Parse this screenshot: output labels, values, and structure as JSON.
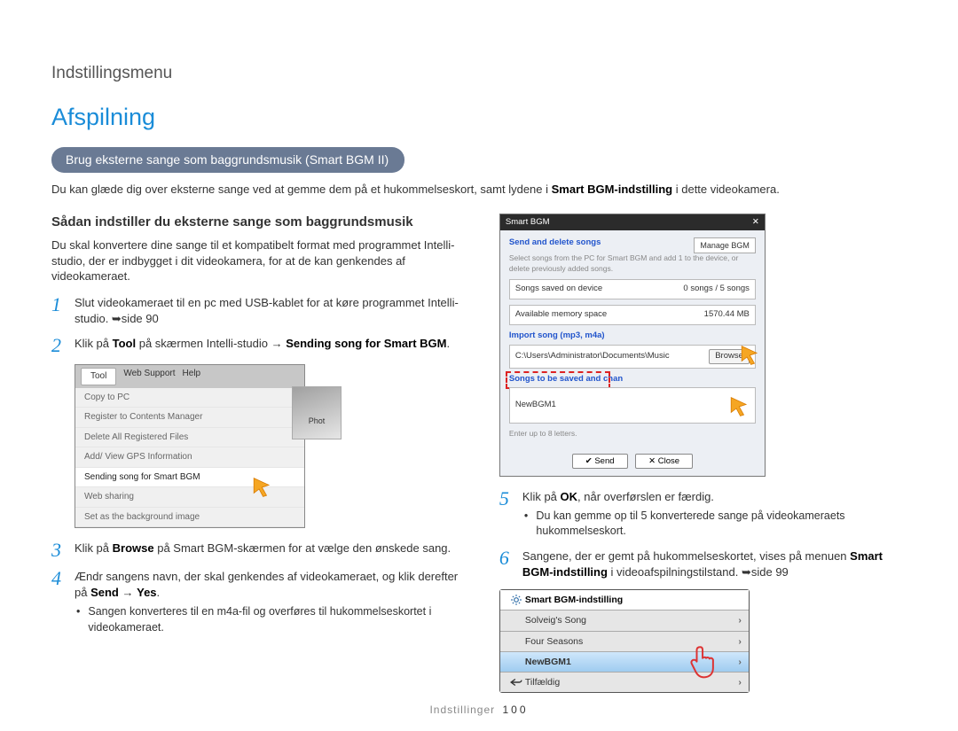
{
  "breadcrumb": "Indstillingsmenu",
  "title": "Afspilning",
  "pill": "Brug eksterne sange som baggrundsmusik (Smart BGM II)",
  "intro_pre": "Du kan glæde dig over eksterne sange ved at gemme dem på et hukommelseskort, samt lydene i ",
  "intro_bold": "Smart BGM-indstilling",
  "intro_post": " i dette videokamera.",
  "subhead": "Sådan indstiller du eksterne sange som baggrundsmusik",
  "para1": "Du skal konvertere dine sange til et kompatibelt format med programmet Intelli-studio, der er indbygget i dit videokamera, for at de kan genkendes af videokameraet.",
  "steps": {
    "s1": {
      "n": "1",
      "t": "Slut videokameraet til en pc med USB-kablet for at køre programmet Intelli-studio. ➥side 90"
    },
    "s2": {
      "n": "2",
      "pre": "Klik på ",
      "b1": "Tool",
      "mid1": " på skærmen Intelli-studio → ",
      "b2": "Sending song for Smart BGM",
      "post": "."
    },
    "s3": {
      "n": "3",
      "pre": "Klik på ",
      "b1": "Browse",
      "post": " på Smart BGM-skærmen for at vælge den ønskede sang."
    },
    "s4": {
      "n": "4",
      "pre": "Ændr sangens navn, der skal genkendes af videokameraet, og klik derefter på ",
      "b1": "Send",
      "mid": " → ",
      "b2": "Yes",
      "post": ".",
      "bullet": "Sangen konverteres til en m4a-fil og overføres til hukommelseskortet i videokameraet."
    },
    "s5": {
      "n": "5",
      "pre": "Klik på ",
      "b1": "OK",
      "post": ", når overførslen er færdig.",
      "bullet": "Du kan gemme op til 5 konverterede sange på videokameraets hukommelseskort."
    },
    "s6": {
      "n": "6",
      "pre": "Sangene, der er gemt på hukommelseskortet, vises på menuen ",
      "b1": "Smart BGM-indstilling",
      "post": " i videoafspilningstilstand. ➥side 99"
    }
  },
  "fig_menu": {
    "tb1": "Tool",
    "tb2": "Web Support",
    "tb3": "Help",
    "items": [
      "Copy to PC",
      "Register to Contents Manager",
      "Delete All Registered Files",
      "Add/ View GPS Information",
      "Sending song for Smart BGM",
      "Web sharing",
      "Set as the background image"
    ],
    "highlight_idx": 4,
    "photo_label": "Phot"
  },
  "fig_dialog": {
    "title": "Smart BGM",
    "link1": "Send and delete songs",
    "mgmt": "Manage BGM",
    "sub1": "Select songs from the PC for Smart BGM and add 1 to the device, or delete previously added songs.",
    "row1_l": "Songs saved on device",
    "row1_r": "0 songs / 5 songs",
    "row2_l": "Available memory space",
    "row2_r": "1570.44 MB",
    "link2": "Import song (mp3, m4a)",
    "path": "C:\\Users\\Administrator\\Documents\\Music",
    "browse": "Browse",
    "link3": "Songs to be saved and chan",
    "name_val": "NewBGM1",
    "name_hint": "Enter up to 8 letters.",
    "btn_send": "Send",
    "btn_close": "Close"
  },
  "fig_cam": {
    "header": "Smart BGM-indstilling",
    "rows": [
      "Solveig's Song",
      "Four Seasons",
      "NewBGM1",
      "Tilfældig"
    ],
    "selected_idx": 2
  },
  "footer_section": "Indstillinger",
  "footer_page": "100"
}
